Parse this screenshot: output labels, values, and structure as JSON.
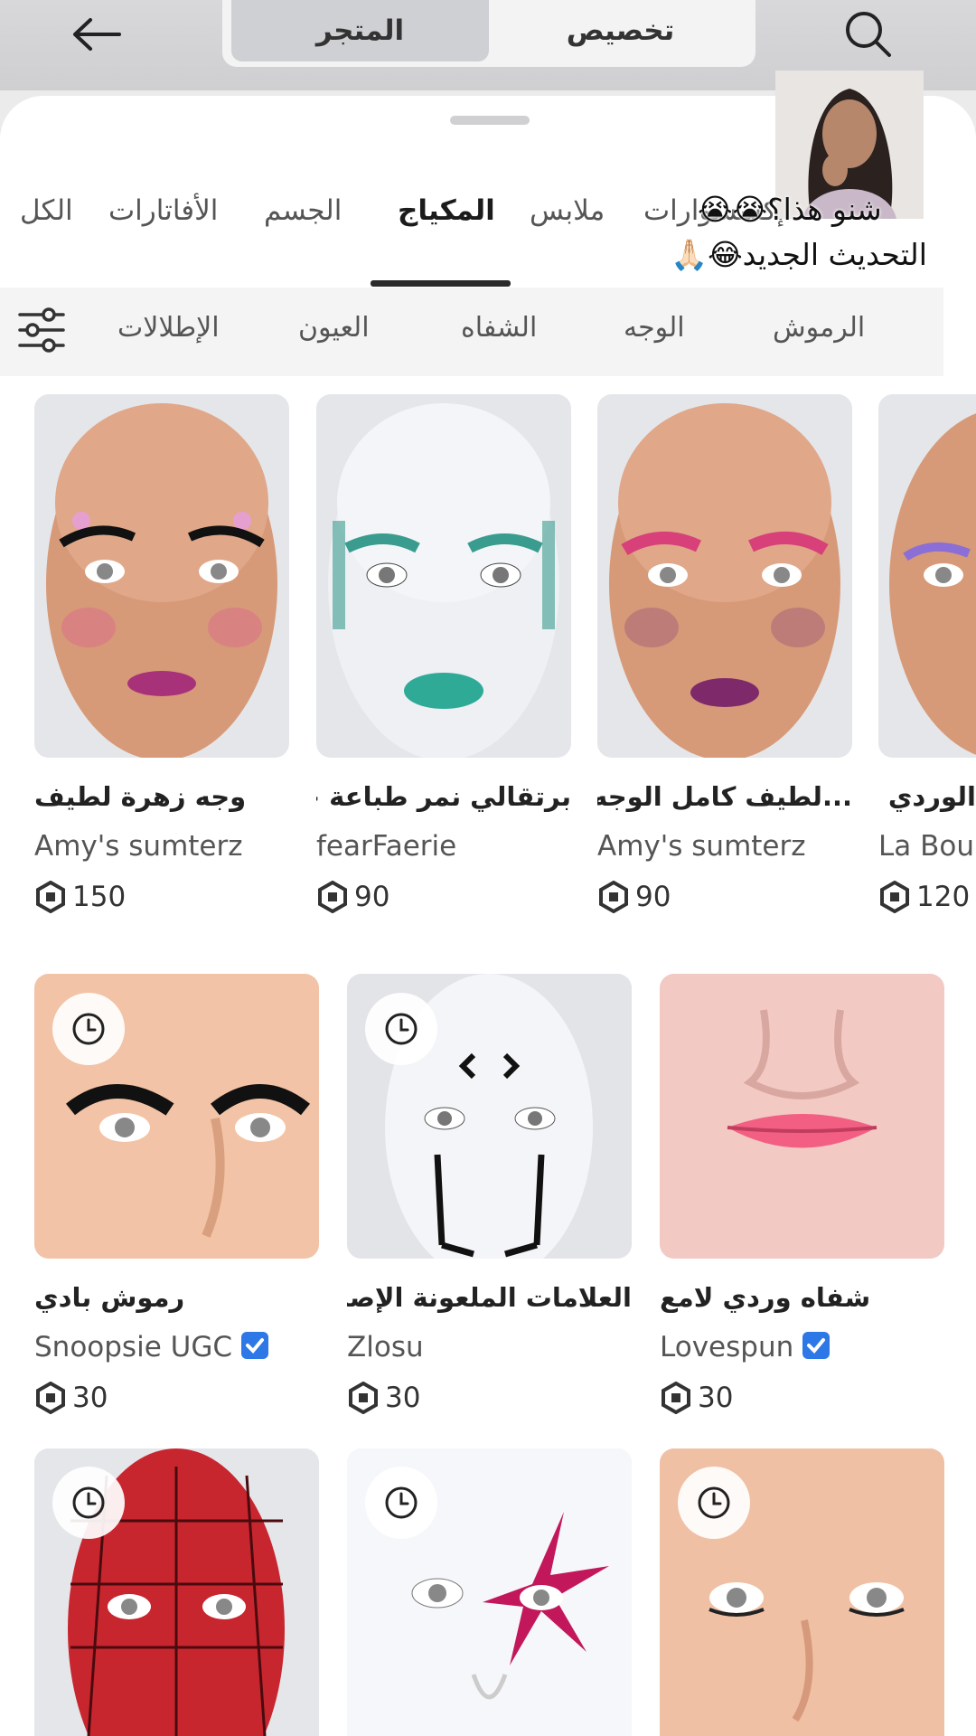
{
  "nav": {
    "tab_store": "المتجر",
    "tab_customize": "تخصيص"
  },
  "categories": [
    "الكل",
    "الأفاتارات",
    "الجسم",
    "المكياج",
    "ملابس",
    "إكسسوارات"
  ],
  "subcategories": [
    "الإطلالات",
    "العيون",
    "الشفاه",
    "الوجه",
    "الرموش"
  ],
  "overlay": {
    "line1": "شنو هذا؟😭😭",
    "line2": "التحديث الجديد😂🙏🏻"
  },
  "items_row1": [
    {
      "title": "وجه زهرة لطيف",
      "creator": "Amy's sumterz",
      "price": "150"
    },
    {
      "title": "برتقالي نمر طباعة جلام",
      "creator": "fearFaerie",
      "price": "90"
    },
    {
      "title": "...لطيف كامل الوجه سحر",
      "creator": "Amy's sumterz",
      "price": "90"
    },
    {
      "title": "الوردي - ة",
      "creator": "La Bou",
      "price": "120"
    }
  ],
  "items_row2": [
    {
      "title": "رموش بادي",
      "creator": "Snoopsie UGC",
      "price": "30",
      "verified": true
    },
    {
      "title": "العلامات الملعونة الإصدار",
      "creator": "Zlosu",
      "price": "30",
      "verified": false
    },
    {
      "title": "شفاه وردي لامع",
      "creator": "Lovespun",
      "price": "30",
      "verified": true
    }
  ],
  "colors": {
    "accent_blue": "#2d78e6",
    "tab_underline": "#2a2a2a"
  }
}
